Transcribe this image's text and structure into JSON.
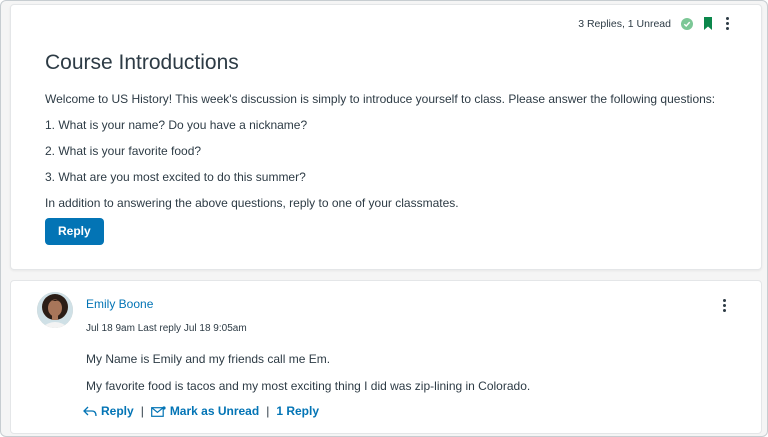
{
  "topic": {
    "meta_text": "3 Replies, 1 Unread",
    "title": "Course Introductions",
    "paragraphs": [
      "Welcome to US History! This week's discussion is simply to introduce yourself to class. Please answer the following questions:",
      "1. What is your name? Do you have a nickname?",
      "2. What is your favorite food?",
      "3. What are you most excited to do this summer?",
      "In addition to answering the above questions, reply to one of your classmates."
    ],
    "reply_label": "Reply"
  },
  "entry": {
    "author": "Emily Boone",
    "timestamps": "Jul 18 9am  Last reply Jul 18 9:05am",
    "paragraphs": [
      "My Name is Emily and my friends call me Em.",
      "My favorite food is tacos and my most exciting thing I did was zip-lining in Colorado."
    ],
    "actions": {
      "reply": "Reply",
      "mark_unread": "Mark as Unread",
      "replies_count": "1 Reply"
    }
  },
  "colors": {
    "brand": "#0374b5",
    "success": "#7cc796",
    "bookmark": "#0b874b",
    "text": "#2d3b45"
  },
  "icons": [
    "check-circle-icon",
    "bookmark-icon",
    "kebab-menu-icon",
    "reply-arrow-icon",
    "envelope-icon"
  ]
}
